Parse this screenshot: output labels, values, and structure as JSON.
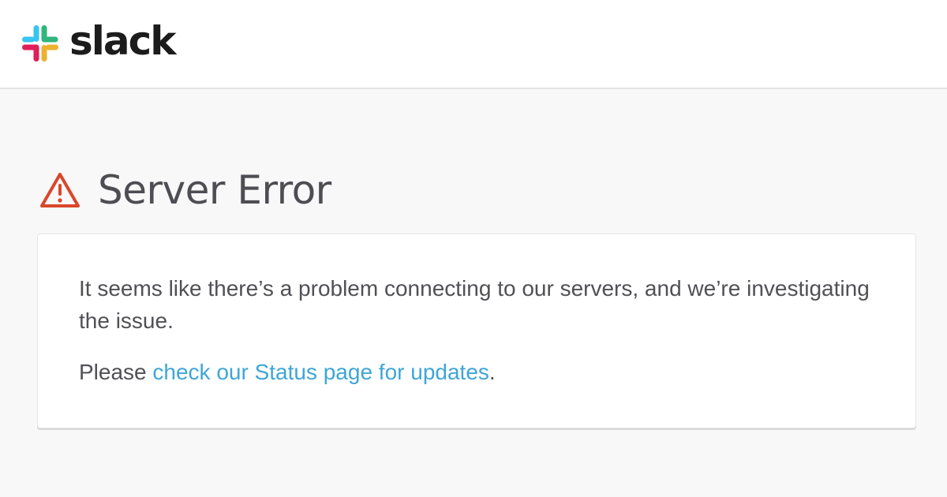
{
  "header": {
    "logo_text": "slack",
    "logo_icon": "slack-hash-icon",
    "brand_colors": [
      "#36c5f0",
      "#2eb67d",
      "#ecb22e",
      "#e01e5a"
    ]
  },
  "error": {
    "icon": "warning-triangle-icon",
    "icon_color": "#d9472b",
    "title": "Server Error",
    "message": "It seems like there’s a problem connecting to our servers, and we’re investigating the issue.",
    "status_prefix": "Please ",
    "status_link": "check our Status page for updates",
    "status_suffix": ".",
    "link_color": "#3ea6d6"
  }
}
